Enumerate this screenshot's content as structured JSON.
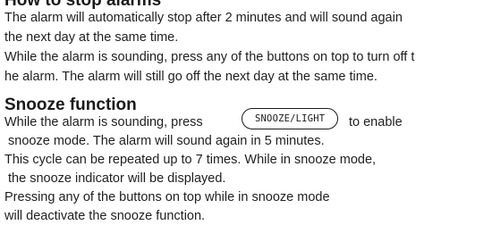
{
  "stop_section": {
    "heading": "How to stop alarms",
    "lines": [
      "The alarm will automatically stop after 2 minutes and will sound again",
      "the next day at the same time.",
      "While the alarm is sounding, press any of the buttons on top to turn off t",
      "he alarm. The alarm will still go off the next day at the same time."
    ]
  },
  "snooze_section": {
    "heading": "Snooze function",
    "line1_before": "While the alarm is sounding, press",
    "button_label": "SNOOZE/LIGHT",
    "line1_after": "to enable",
    "lines": [
      " snooze mode. The alarm will sound again in 5 minutes.",
      "This cycle can be repeated up to 7 times. While in snooze mode,",
      " the snooze indicator will be displayed.",
      "Pressing any of the buttons on top while in snooze mode",
      "will deactivate the snooze function."
    ]
  }
}
